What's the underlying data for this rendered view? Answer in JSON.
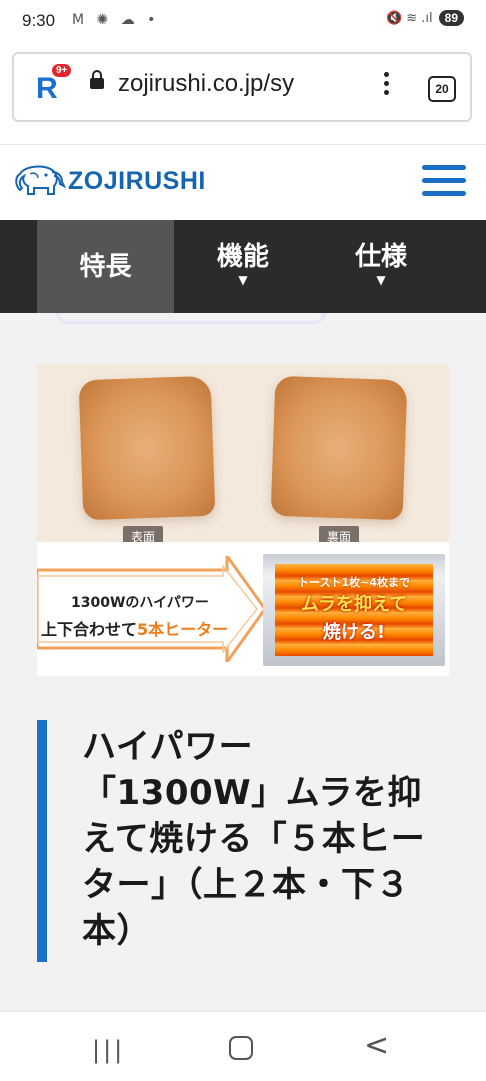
{
  "status_bar": {
    "time": "9:30",
    "left_icons": "M ✺ ☁ •",
    "right_icons": "🔇 ≋ .ıl",
    "battery": "89"
  },
  "browser": {
    "url": "zojirushi.co.jp/sy",
    "tab_count": "20",
    "site_badge": "R",
    "notification_badge": "9+"
  },
  "site_header": {
    "logo_text": "ZOJIRUSHI"
  },
  "nav_tabs": [
    {
      "label": "特長",
      "active": true,
      "caret": ""
    },
    {
      "label": "機能",
      "active": false,
      "caret": "▼"
    },
    {
      "label": "仕様",
      "active": false,
      "caret": "▼"
    }
  ],
  "promo_image": {
    "toast_labels": [
      "表面",
      "裏面"
    ],
    "line1": "1300Wのハイパワー",
    "line2_prefix": "上下合わせて",
    "line2_accent": "5本ヒーター",
    "heater_line1": "トースト1枚~4枚まで",
    "heater_line2": "ムラを抑えて",
    "heater_line3": "焼ける!"
  },
  "headline": "ハイパワー「1300W」ムラを抑えて焼ける「５本ヒーター」（上２本・下３本）",
  "system_nav": {
    "recents": "|||",
    "back": "<"
  }
}
